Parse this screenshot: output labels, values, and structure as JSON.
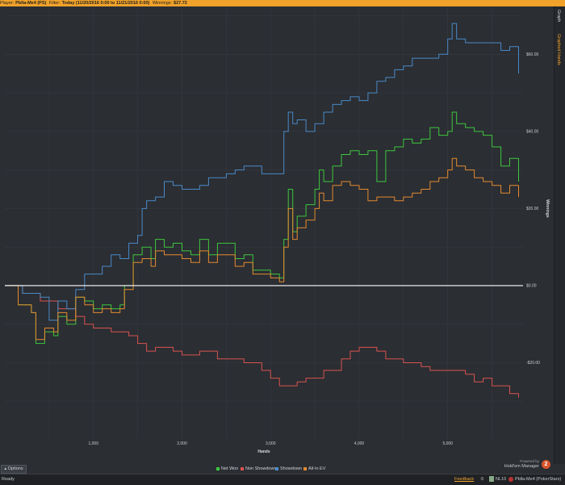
{
  "header": {
    "player_label": "Player:",
    "player_name": "Pblla-Me4 (PS)",
    "filter_label": "Filter:",
    "filter_value": "Today (11/20/2016 0:00 to 11/21/2016 0:00)",
    "winnings_label": "Winnings:",
    "winnings_value": "$27.72"
  },
  "side_tabs": {
    "graph": "Graph",
    "graphed_hands": "Graphed Hands"
  },
  "options_label": "Options",
  "status": {
    "ready": "Ready",
    "feedback": "Feedback",
    "limit": "NL10",
    "player": "Pblla-Me4 (PokerStars)",
    "brand_top": "Powered by",
    "brand_name": "Hold'em Manager"
  },
  "colors": {
    "net_won": "#3ec63e",
    "non_showdown": "#d9534f",
    "showdown": "#4a8ac9",
    "all_in_ev": "#e48a2f",
    "zero_line": "#ffffff",
    "accent": "#f0a22a"
  },
  "chart_data": {
    "type": "line",
    "xlabel": "Hands",
    "ylabel": "Winnings",
    "xlim": [
      0,
      5850
    ],
    "ylim": [
      -40,
      72
    ],
    "x_ticks": [
      1000,
      2000,
      3000,
      4000,
      5000
    ],
    "x_tick_labels": [
      "1,000",
      "2,000",
      "3,000",
      "4,000",
      "5,000"
    ],
    "y_ticks": [
      -20,
      0,
      20,
      40,
      60
    ],
    "y_tick_labels": [
      "-$20.00",
      "$0.00",
      "$20.00",
      "$40.00",
      "$60.00"
    ],
    "grid": true,
    "legend_position": "bottom-center",
    "series": [
      {
        "name": "Net Won",
        "key": "net_won",
        "x": [
          0,
          150,
          300,
          350,
          450,
          550,
          600,
          700,
          800,
          900,
          1000,
          1100,
          1200,
          1300,
          1350,
          1450,
          1550,
          1650,
          1700,
          1800,
          1900,
          2000,
          2100,
          2200,
          2300,
          2400,
          2500,
          2600,
          2700,
          2800,
          2900,
          3000,
          3100,
          3150,
          3200,
          3250,
          3300,
          3400,
          3500,
          3550,
          3600,
          3700,
          3800,
          3900,
          4000,
          4100,
          4200,
          4300,
          4400,
          4500,
          4600,
          4700,
          4800,
          4900,
          5000,
          5050,
          5100,
          5200,
          5300,
          5400,
          5500,
          5600,
          5700,
          5800
        ],
        "values": [
          0,
          -5,
          -7,
          -15,
          -12,
          -13,
          -8,
          -10,
          -3,
          -4,
          -6,
          -5,
          -6,
          -5,
          0,
          8,
          10,
          7,
          12,
          10,
          11,
          9,
          8,
          12,
          8,
          11,
          11,
          7,
          8,
          4,
          4,
          3,
          2,
          12,
          25,
          14,
          18,
          21,
          25,
          30,
          27,
          31,
          34,
          35,
          34,
          35,
          27,
          35,
          36,
          38,
          37,
          38,
          41,
          39,
          40,
          45,
          42,
          41,
          40,
          39,
          36,
          31,
          33,
          27
        ]
      },
      {
        "name": "Non Showdown",
        "key": "non_showdown",
        "x": [
          0,
          200,
          400,
          600,
          700,
          800,
          900,
          1000,
          1200,
          1400,
          1500,
          1600,
          1700,
          1900,
          2000,
          2100,
          2200,
          2300,
          2400,
          2500,
          2700,
          2900,
          3000,
          3100,
          3200,
          3300,
          3400,
          3600,
          3800,
          3900,
          4000,
          4200,
          4300,
          4400,
          4500,
          4600,
          4700,
          4800,
          5000,
          5200,
          5300,
          5400,
          5500,
          5600,
          5700,
          5800
        ],
        "values": [
          0,
          -2,
          -4,
          -6,
          -6,
          -8,
          -10,
          -11,
          -12,
          -13,
          -15,
          -17,
          -16,
          -17,
          -18,
          -18,
          -17,
          -17,
          -19,
          -19,
          -20,
          -22,
          -24,
          -26,
          -26,
          -25,
          -24,
          -22,
          -19,
          -17,
          -16,
          -17,
          -19,
          -19,
          -20,
          -20,
          -21,
          -22,
          -22,
          -23,
          -25,
          -24,
          -26,
          -26,
          -28,
          -29
        ]
      },
      {
        "name": "Showdown",
        "key": "showdown",
        "x": [
          0,
          200,
          400,
          500,
          600,
          700,
          800,
          900,
          1000,
          1100,
          1200,
          1300,
          1400,
          1500,
          1550,
          1600,
          1700,
          1800,
          1900,
          2000,
          2100,
          2200,
          2300,
          2400,
          2500,
          2600,
          2700,
          2800,
          2900,
          3000,
          3100,
          3150,
          3200,
          3250,
          3300,
          3400,
          3500,
          3600,
          3700,
          3800,
          3900,
          4000,
          4100,
          4200,
          4300,
          4400,
          4500,
          4600,
          4700,
          4800,
          4900,
          5000,
          5050,
          5100,
          5200,
          5300,
          5400,
          5500,
          5600,
          5700,
          5800
        ],
        "values": [
          0,
          -2,
          -3,
          -9,
          -4,
          -6,
          -1,
          3,
          3,
          5,
          8,
          7,
          11,
          13,
          20,
          22,
          23,
          27,
          26,
          25,
          25,
          26,
          28,
          28,
          29,
          30,
          31,
          31,
          29,
          29,
          29,
          40,
          45,
          42,
          43,
          40,
          42,
          45,
          47,
          48,
          49,
          48,
          50,
          53,
          54,
          56,
          57,
          59,
          59,
          59,
          60,
          64,
          68,
          64,
          63,
          63,
          63,
          63,
          61,
          62,
          55
        ]
      },
      {
        "name": "All-In EV",
        "key": "all_in_ev",
        "x": [
          0,
          150,
          300,
          350,
          450,
          550,
          600,
          700,
          800,
          900,
          1000,
          1100,
          1200,
          1300,
          1350,
          1450,
          1550,
          1650,
          1700,
          1800,
          1900,
          2000,
          2100,
          2200,
          2300,
          2400,
          2500,
          2600,
          2700,
          2800,
          2900,
          3000,
          3100,
          3150,
          3200,
          3250,
          3300,
          3400,
          3500,
          3550,
          3600,
          3700,
          3800,
          3900,
          4000,
          4100,
          4200,
          4300,
          4400,
          4500,
          4600,
          4700,
          4800,
          4900,
          5000,
          5050,
          5100,
          5200,
          5300,
          5400,
          5500,
          5600,
          5700,
          5800
        ],
        "values": [
          0,
          -5,
          -7,
          -14,
          -11,
          -12,
          -7,
          -9,
          -3,
          -5,
          -7,
          -6,
          -7,
          -6,
          -1,
          6,
          7,
          5,
          9,
          8,
          8,
          7,
          6,
          9,
          6,
          8,
          8,
          5,
          6,
          3,
          3,
          2,
          1,
          10,
          20,
          12,
          15,
          17,
          20,
          24,
          22,
          26,
          27,
          26,
          25,
          22,
          23,
          23,
          22,
          23,
          24,
          25,
          27,
          28,
          30,
          33,
          31,
          30,
          28,
          27,
          26,
          24,
          26,
          23
        ]
      }
    ]
  }
}
